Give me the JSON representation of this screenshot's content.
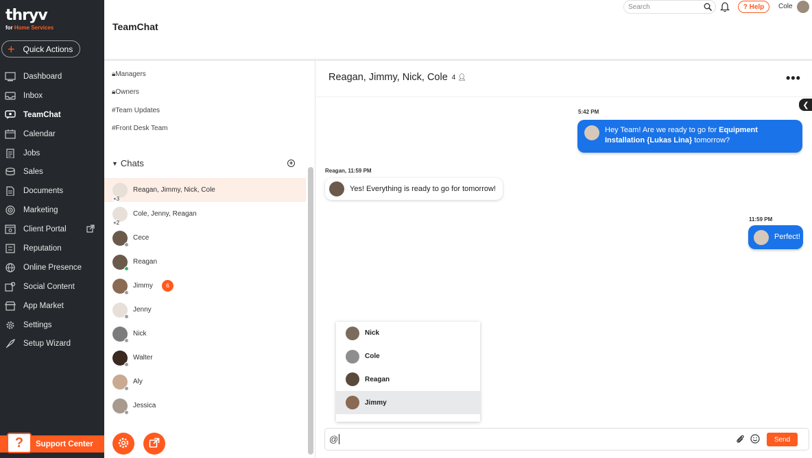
{
  "brand": {
    "logo": "thryv",
    "subtitle_prefix": "for ",
    "subtitle_highlight": "Home Services",
    "accent": "#ff5a1f",
    "sidebar_bg": "#25282c"
  },
  "quick_actions": {
    "label": "Quick Actions"
  },
  "nav": {
    "items": [
      {
        "label": "Dashboard",
        "icon": "dashboard-icon"
      },
      {
        "label": "Inbox",
        "icon": "inbox-icon"
      },
      {
        "label": "TeamChat",
        "icon": "chat-icon"
      },
      {
        "label": "Calendar",
        "icon": "calendar-icon"
      },
      {
        "label": "Jobs",
        "icon": "clipboard-icon"
      },
      {
        "label": "Sales",
        "icon": "sales-icon"
      },
      {
        "label": "Documents",
        "icon": "document-icon"
      },
      {
        "label": "Marketing",
        "icon": "target-icon"
      },
      {
        "label": "Client Portal",
        "icon": "portal-icon"
      },
      {
        "label": "Reputation",
        "icon": "reputation-icon"
      },
      {
        "label": "Online Presence",
        "icon": "globe-icon"
      },
      {
        "label": "Social Content",
        "icon": "social-icon"
      },
      {
        "label": "App Market",
        "icon": "store-icon"
      },
      {
        "label": "Settings",
        "icon": "gear-icon"
      },
      {
        "label": "Setup Wizard",
        "icon": "rocket-icon"
      }
    ]
  },
  "support": {
    "label": "Support Center",
    "q": "?"
  },
  "topbar": {
    "search_placeholder": "Search",
    "help_label": "? Help",
    "user_name": "Cole"
  },
  "page": {
    "title": "TeamChat"
  },
  "channels": [
    "Managers",
    "Owners",
    "#Team Updates",
    "#Front Desk Team"
  ],
  "chats": {
    "header": "Chats",
    "items": [
      {
        "name": "Reagan, Jimmy, Nick, Cole",
        "extra": "+3"
      },
      {
        "name": "Cole, Jenny, Reagan",
        "extra": "+2"
      },
      {
        "name": "Cece"
      },
      {
        "name": "Reagan"
      },
      {
        "name": "Jimmy",
        "badge": "6"
      },
      {
        "name": "Jenny"
      },
      {
        "name": "Nick"
      },
      {
        "name": "Walter"
      },
      {
        "name": "Aly"
      },
      {
        "name": "Jessica"
      }
    ]
  },
  "conversation": {
    "title": "Reagan, Jimmy, Nick, Cole",
    "member_count": "4",
    "messages": [
      {
        "time": "5:42 PM",
        "pre": "Hey Team! Are we ready to go for ",
        "bold": "Equipment Installation {Lukas Lina}",
        "post": " tomorrow?"
      },
      {
        "time": "Reagan, 11:59 PM",
        "text": "Yes!  Everything is ready to go for tomorrow!"
      },
      {
        "time": "11:59 PM",
        "text": "Perfect!"
      }
    ],
    "mentions": [
      "Nick",
      "Cole",
      "Reagan",
      "Jimmy"
    ],
    "composer_value": "@",
    "send_label": "Send"
  }
}
